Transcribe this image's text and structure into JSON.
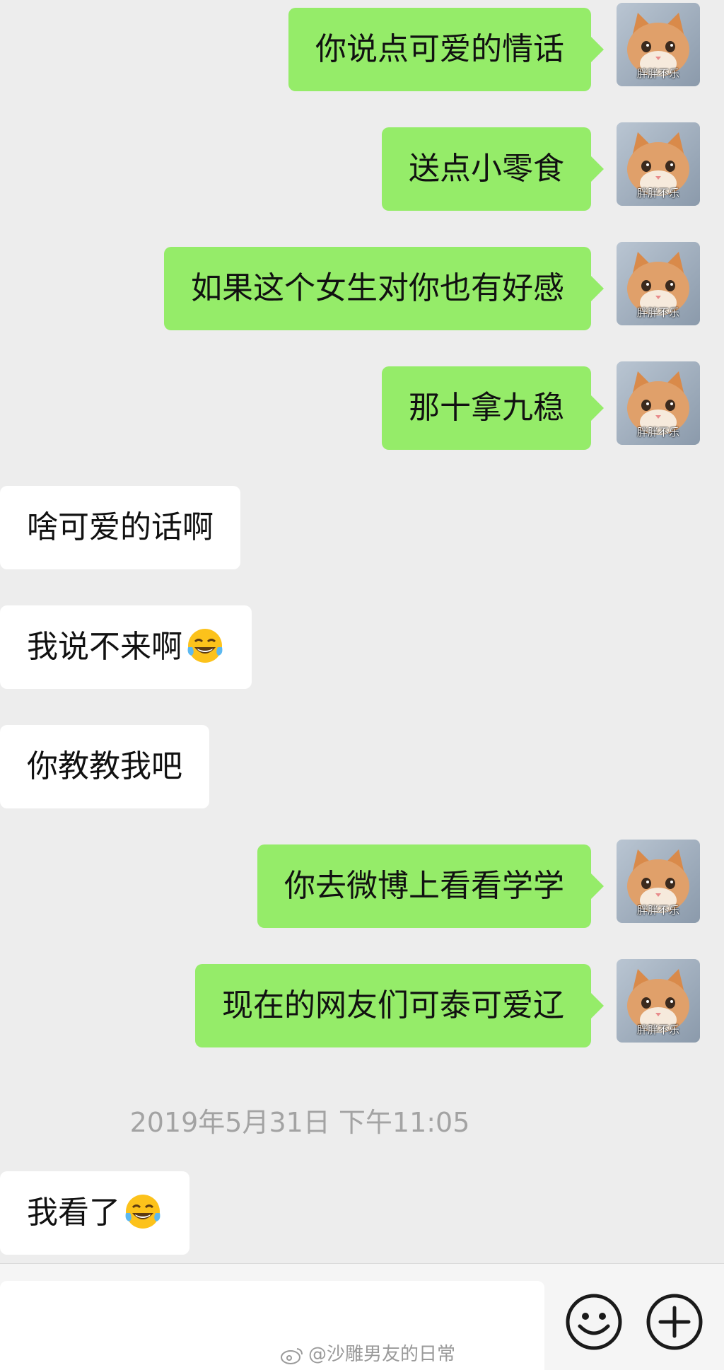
{
  "messages": [
    {
      "side": "me",
      "text": "你说点可爱的情话",
      "avatar_caption": "胖胖不乐"
    },
    {
      "side": "me",
      "text": "送点小零食",
      "avatar_caption": "胖胖不乐"
    },
    {
      "side": "me",
      "text": "如果这个女生对你也有好感",
      "avatar_caption": "胖胖不乐"
    },
    {
      "side": "me",
      "text": "那十拿九稳",
      "avatar_caption": "胖胖不乐"
    },
    {
      "side": "them",
      "text": "啥可爱的话啊"
    },
    {
      "side": "them",
      "text": "我说不来啊",
      "emoji": "tears-of-joy-emoji"
    },
    {
      "side": "them",
      "text": "你教教我吧"
    },
    {
      "side": "me",
      "text": "你去微博上看看学学",
      "avatar_caption": "胖胖不乐"
    },
    {
      "side": "me",
      "text": "现在的网友们可泰可爱辽",
      "avatar_caption": "胖胖不乐"
    },
    {
      "side": "them",
      "text": "我看了",
      "emoji": "tears-of-joy-emoji"
    }
  ],
  "timestamp": "2019年5月31日 下午11:05",
  "input_bar": {
    "emoji_button_icon": "smiley-face-icon",
    "plus_button_icon": "plus-circle-icon"
  },
  "watermark": "@沙雕男友的日常",
  "colors": {
    "my_bubble": "#95ec69",
    "their_bubble": "#ffffff",
    "background": "#ededed",
    "timestamp": "#a3a3a3"
  }
}
